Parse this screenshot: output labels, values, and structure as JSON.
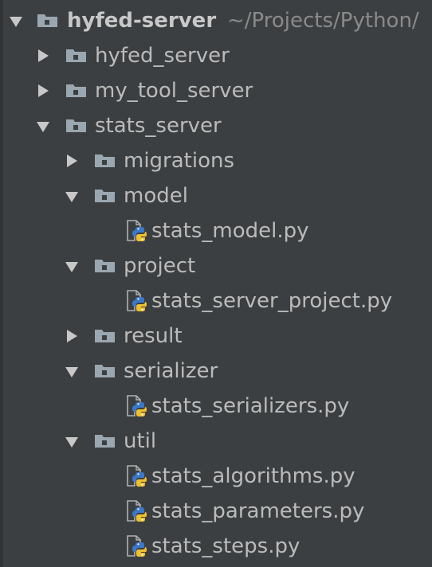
{
  "project_tree": {
    "root": {
      "name": "hyfed-server",
      "path": "~/Projects/Python/"
    },
    "items": [
      {
        "name": "hyfed_server",
        "type": "folder",
        "state": "collapsed"
      },
      {
        "name": "my_tool_server",
        "type": "folder",
        "state": "collapsed"
      },
      {
        "name": "stats_server",
        "type": "folder",
        "state": "expanded"
      },
      {
        "name": "migrations",
        "type": "folder",
        "state": "collapsed"
      },
      {
        "name": "model",
        "type": "folder",
        "state": "expanded"
      },
      {
        "name": "stats_model.py",
        "type": "python-file"
      },
      {
        "name": "project",
        "type": "folder",
        "state": "expanded"
      },
      {
        "name": "stats_server_project.py",
        "type": "python-file"
      },
      {
        "name": "result",
        "type": "folder",
        "state": "collapsed"
      },
      {
        "name": "serializer",
        "type": "folder",
        "state": "expanded"
      },
      {
        "name": "stats_serializers.py",
        "type": "python-file"
      },
      {
        "name": "util",
        "type": "folder",
        "state": "expanded"
      },
      {
        "name": "stats_algorithms.py",
        "type": "python-file"
      },
      {
        "name": "stats_parameters.py",
        "type": "python-file"
      },
      {
        "name": "stats_steps.py",
        "type": "python-file"
      }
    ]
  },
  "colors": {
    "background": "#3c3f41",
    "text": "#bbbbbb",
    "path_text": "#8a8a8a",
    "folder_icon": "#9aa7b0",
    "python_blue": "#3c78c8",
    "python_yellow": "#f0c030"
  }
}
